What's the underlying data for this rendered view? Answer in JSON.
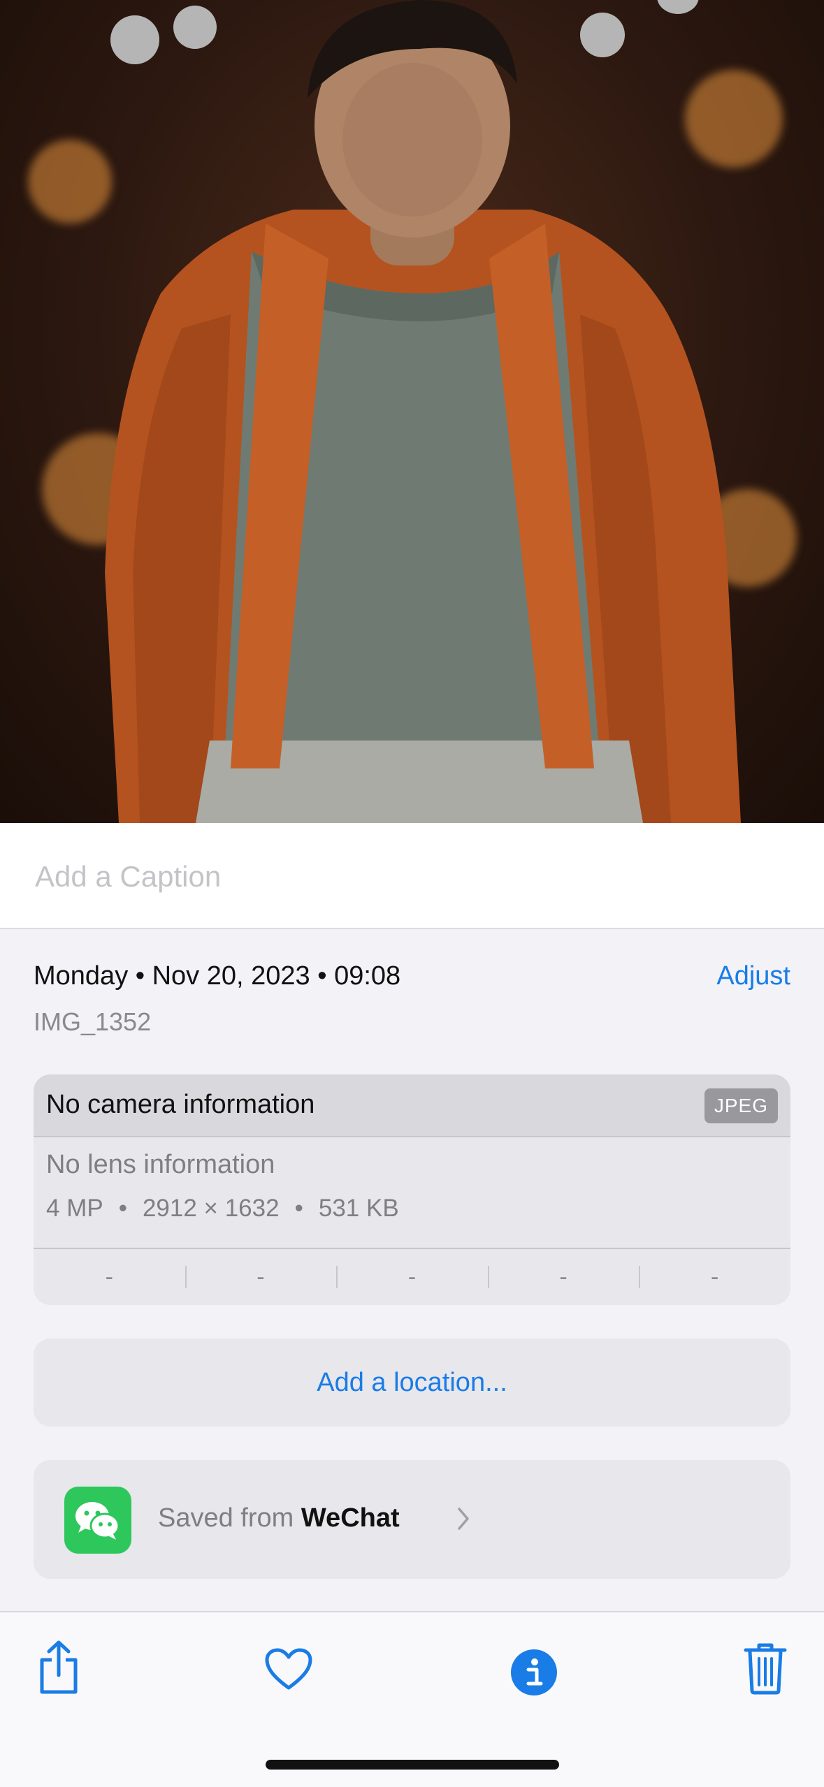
{
  "photo": {
    "description_icon": "photo-icon"
  },
  "caption": {
    "placeholder": "Add a Caption",
    "value": ""
  },
  "info": {
    "date_line": "Monday • Nov 20, 2023 • 09:08",
    "adjust_label": "Adjust",
    "filename": "IMG_1352"
  },
  "camera": {
    "title": "No camera information",
    "format_badge": "JPEG",
    "lens": "No lens information",
    "specs": [
      "4 MP",
      "•",
      "2912 × 1632",
      "•",
      "531 KB"
    ],
    "exif": [
      "-",
      "-",
      "-",
      "-",
      "-"
    ]
  },
  "location": {
    "label": "Add a location..."
  },
  "source": {
    "prefix": "Saved from",
    "app": "WeChat",
    "icon": "wechat-icon"
  },
  "toolbar": {
    "share_icon": "share-icon",
    "favorite_icon": "heart-icon",
    "info_icon": "info-icon",
    "delete_icon": "trash-icon"
  },
  "colors": {
    "accent": "#1a7ce6",
    "wechat": "#2dc75c",
    "background": "#f2f2f7"
  }
}
